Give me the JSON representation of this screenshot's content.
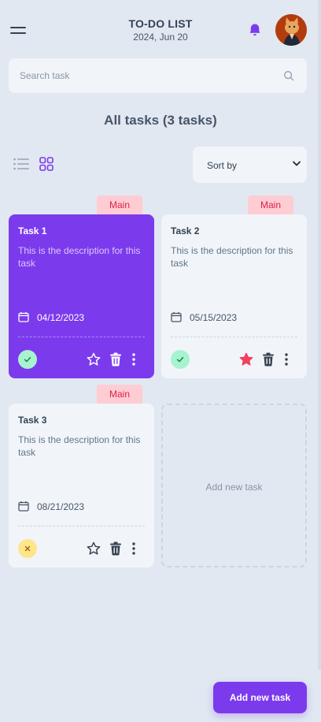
{
  "header": {
    "title": "TO-DO LIST",
    "date": "2024, Jun 20",
    "icons": [
      "menu-icon",
      "bell-icon",
      "avatar"
    ]
  },
  "search": {
    "placeholder": "Search task",
    "icon": "search-icon"
  },
  "heading": "All tasks (3 tasks)",
  "view_toggle": {
    "list_icon": "list-view-icon",
    "grid_icon": "grid-view-icon",
    "selected": "grid"
  },
  "sort": {
    "label": "Sort by"
  },
  "tasks": [
    {
      "badge": "Main",
      "title": "Task 1",
      "description": "This is the description for this task",
      "date": "04/12/2023",
      "completed": true,
      "starred": false,
      "highlighted": true
    },
    {
      "badge": "Main",
      "title": "Task 2",
      "description": "This is the description for this task",
      "date": "05/15/2023",
      "completed": true,
      "starred": true,
      "highlighted": false
    },
    {
      "badge": "Main",
      "title": "Task 3",
      "description": "This is the description for this task",
      "date": "08/21/2023",
      "completed": false,
      "starred": false,
      "highlighted": false
    }
  ],
  "add_card_label": "Add new task",
  "fab_label": "Add new task",
  "colors": {
    "background": "#e1e8f1",
    "accent": "#7c3aed",
    "badge_bg": "#fecdd3",
    "badge_text": "#e11d48",
    "done": "#a7f3d0",
    "pending": "#fde68a",
    "star_active": "#f43f5e"
  }
}
